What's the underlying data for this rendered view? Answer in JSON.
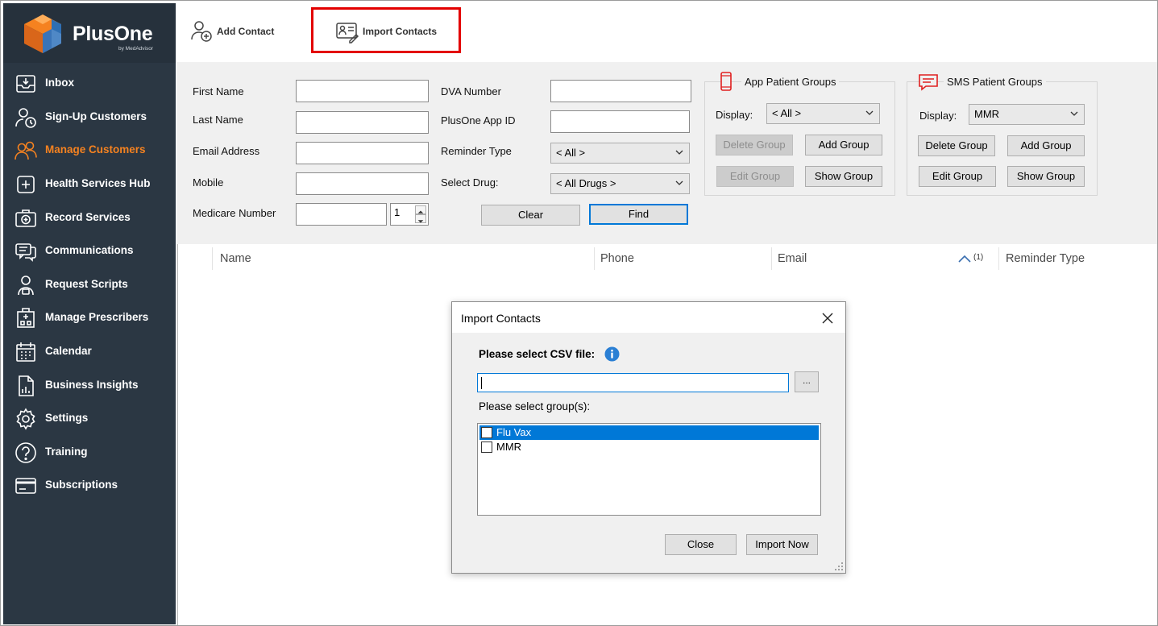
{
  "app": {
    "brand": "PlusOne",
    "brand_sub": "by MedAdvisor"
  },
  "colors": {
    "sidebar_bg": "#2b3743",
    "accent_orange": "#f58220",
    "highlight_red": "#e30000",
    "selection_blue": "#0078d7"
  },
  "sidebar": {
    "items": [
      {
        "label": "Inbox",
        "icon": "inbox-icon"
      },
      {
        "label": "Sign-Up Customers",
        "icon": "signup-customers-icon"
      },
      {
        "label": "Manage Customers",
        "icon": "manage-customers-icon",
        "active": true
      },
      {
        "label": "Health Services Hub",
        "icon": "health-services-icon"
      },
      {
        "label": "Record Services",
        "icon": "record-services-icon"
      },
      {
        "label": "Communications",
        "icon": "communications-icon"
      },
      {
        "label": "Request Scripts",
        "icon": "request-scripts-icon"
      },
      {
        "label": "Manage Prescribers",
        "icon": "prescribers-icon"
      },
      {
        "label": "Calendar",
        "icon": "calendar-icon"
      },
      {
        "label": "Business Insights",
        "icon": "insights-icon"
      },
      {
        "label": "Settings",
        "icon": "gear-icon"
      },
      {
        "label": "Training",
        "icon": "question-icon"
      },
      {
        "label": "Subscriptions",
        "icon": "card-icon"
      }
    ]
  },
  "toolbar": {
    "add_contact": "Add Contact",
    "import_contacts": "Import Contacts"
  },
  "search": {
    "first_name_label": "First Name",
    "last_name_label": "Last Name",
    "email_label": "Email Address",
    "mobile_label": "Mobile",
    "medicare_label": "Medicare Number",
    "medicare_irn": "1",
    "dva_label": "DVA Number",
    "app_id_label": "PlusOne App ID",
    "reminder_type_label": "Reminder Type",
    "reminder_type_value": "< All >",
    "select_drug_label": "Select Drug:",
    "select_drug_value": "< All Drugs >",
    "clear_button": "Clear",
    "find_button": "Find"
  },
  "app_groups": {
    "title": "App Patient Groups",
    "display_label": "Display:",
    "display_value": "< All >",
    "delete_group": "Delete Group",
    "add_group": "Add Group",
    "edit_group": "Edit Group",
    "show_group": "Show Group"
  },
  "sms_groups": {
    "title": "SMS Patient Groups",
    "display_label": "Display:",
    "display_value": "MMR",
    "delete_group": "Delete Group",
    "add_group": "Add Group",
    "edit_group": "Edit Group",
    "show_group": "Show Group"
  },
  "table": {
    "columns": [
      "Name",
      "Phone",
      "Email",
      "Reminder Type"
    ],
    "sort_marker": "(1)"
  },
  "dialog": {
    "title": "Import Contacts",
    "csv_label": "Please select CSV file:",
    "csv_value": "",
    "browse_label": "...",
    "group_label": "Please select group(s):",
    "groups": [
      {
        "name": "Flu Vax",
        "selected": true,
        "checked": false
      },
      {
        "name": "MMR",
        "selected": false,
        "checked": false
      }
    ],
    "close_button": "Close",
    "import_button": "Import Now"
  }
}
